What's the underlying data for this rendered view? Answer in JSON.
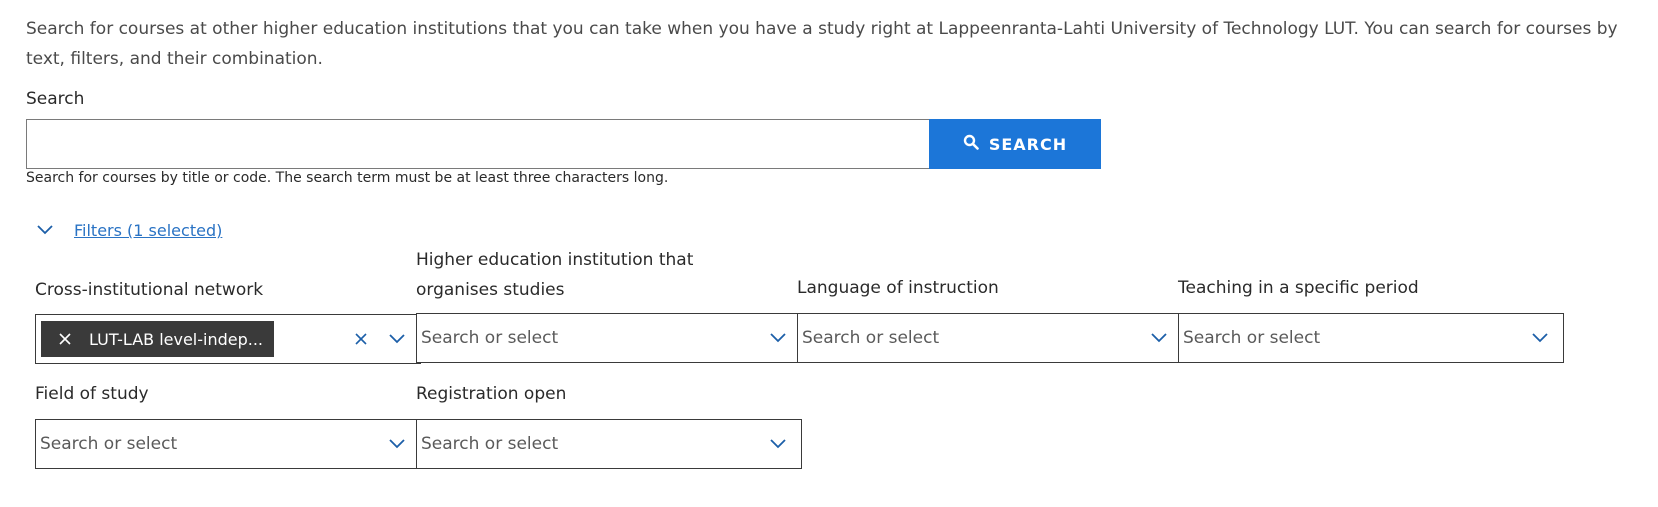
{
  "intro": {
    "text": "Search for courses at other higher education institutions that you can take when you have a study right at Lappeenranta-Lahti University of Technology LUT. You can search for courses by text, filters, and their combination."
  },
  "search": {
    "label": "Search",
    "value": "",
    "placeholder": "",
    "button_label": "SEARCH",
    "button_icon": "search-icon",
    "help_text": "Search for courses by title or code. The search term must be at least three characters long."
  },
  "filters": {
    "toggle_label": "Filters (1 selected)",
    "toggle_icon": "chevron-down-icon",
    "fields": [
      {
        "label": "Cross-institutional network",
        "placeholder": "",
        "selected_chip": "LUT-LAB level-indep..."
      },
      {
        "label": "Higher education institution that organises studies",
        "placeholder": "Search or select"
      },
      {
        "label": "Language of instruction",
        "placeholder": "Search or select"
      },
      {
        "label": "Teaching in a specific period",
        "placeholder": "Search or select"
      },
      {
        "label": "Field of study",
        "placeholder": "Search or select"
      },
      {
        "label": "Registration open",
        "placeholder": "Search or select"
      }
    ]
  },
  "colors": {
    "accent": "#1c76d8",
    "link": "#2a73c4",
    "chip_bg": "#3a3a3a"
  }
}
